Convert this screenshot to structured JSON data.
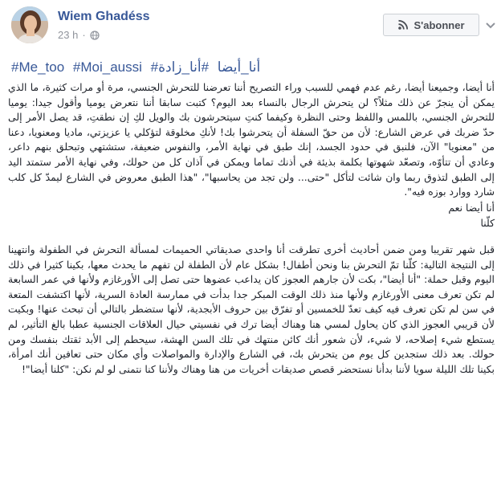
{
  "author": {
    "name": "Wiem Ghadéss",
    "time": "23 h"
  },
  "header": {
    "subscribe_label": "S'abonner"
  },
  "icons": {
    "privacy": "globe-icon",
    "subscribe": "rss-icon",
    "more": "chevron-down-icon"
  },
  "colors": {
    "link": "#385898",
    "meta": "#90949c",
    "text": "#1d2129"
  },
  "hashtags": [
    "#Me_too",
    "#Moi_aussi",
    "#أنا_أيضا",
    "#أنا_زادة"
  ],
  "paragraphs": [
    "أنا أيضا، وجميعنا أيضا، رغم عدم فهمي للسبب وراء التصريح أننا تعرضنا للتحرش الجنسي، مرة أو مرات كثيرة، ما الذي يمكن أن ينجرّ عن ذلك مثلاً؟ لن يتحرش الرجال بالنساء بعد اليوم؟ كتبت سابقا أننا نتعرض يوميا وأقول جيدا: يوميا للتحرش الجنسي، باللمس واللفظ وحتى النظرة وكيفما كنتِ سيتحرشون بك والويل لكِ إن نطقتِ، قد يصل الأمر إلى حدّ ضربك في عرض الشارع: لأن من حقّ السفلة أن يتحرشوا بك! لأنكِ مخلوقة لتؤكلي يا عزيزتي، ماديا ومعنويا، دعنا من \"معنويا\" الآن، فلنبق في حدود الجسد، إنك طبق في نهاية الأمر، والنفوس ضعيفة، ستشتهي وتبحلق بنهم داعر، وعادي أن تتأوّه، وتصعّد شهوتها بكلمة بذيئة في أذنك تماما ويمكن في آذان كل من حولك، وفي نهاية الأمر ستمتد اليد إلى الطبق لتذوق ربما وان شائت لتأكل \"حتى... ولن تجد من يحاسبها\"، \"هذا الطبق معروض في الشارع ليمدّ كل كلب شارد ووارد بوزه فيه\".",
    "أنا أيضا نعم",
    "كلّنا",
    "قبل شهر تقريبا ومن ضمن أحاديث أخرى تطرقت أنا واحدى صديقاتي الحميمات لمسألة التحرش في الطفولة وانتهينا إلى النتيجة التالية: كلّنا تمّ التحرش بنا ونحن أطفال! بشكل عام لأن الطفلة لن تفهم ما يحدث معها، بكينا كثيرا في ذلك اليوم وقبل حملة: \"أنا أيضا\"، بكت لأن جارهم العجوز كان يداعب عضوها حتى تصل إلى الأورغازم ولأنها في عمر السابعة لم تكن تعرف معنى الأورغازم ولأنها منذ ذلك الوقت المبكر جدا بدأت في ممارسة العادة السرية، لأنها اكتشفت المتعة في سن لم تكن تعرف فيه كيف تعدّ للخمسين أو تفرّق بين حروف الأبجدية، لأنها ستضطر بالتالي أن تبحث عنها! وبكيت لأن قريبي العجوز الذي كان يحاول لمسي هنا وهناك أيضا ترك في نفسيتي حيال العلاقات الجنسية عطبا بالغ التأثير، لم يستطع شيء إصلاحه، لا شيء، لأن شعور أنك كائن منتهك في تلك السن الهشة، سيحطم إلى الأبد ثقتك بنفسك ومن حولك. بعد ذلك ستجدين كل يوم من يتحرش بك، في الشارع والإدارة والمواصلات وأي مكان حتى تعافين أنك امرأة، بكينا تلك الليلة سويا لأننا بدأنا نستحضر قصص صديقات أخريات من هنا وهناك ولأننا كنا نتمنى لو لم نكن: \"كلنا أيضا\"!"
  ]
}
